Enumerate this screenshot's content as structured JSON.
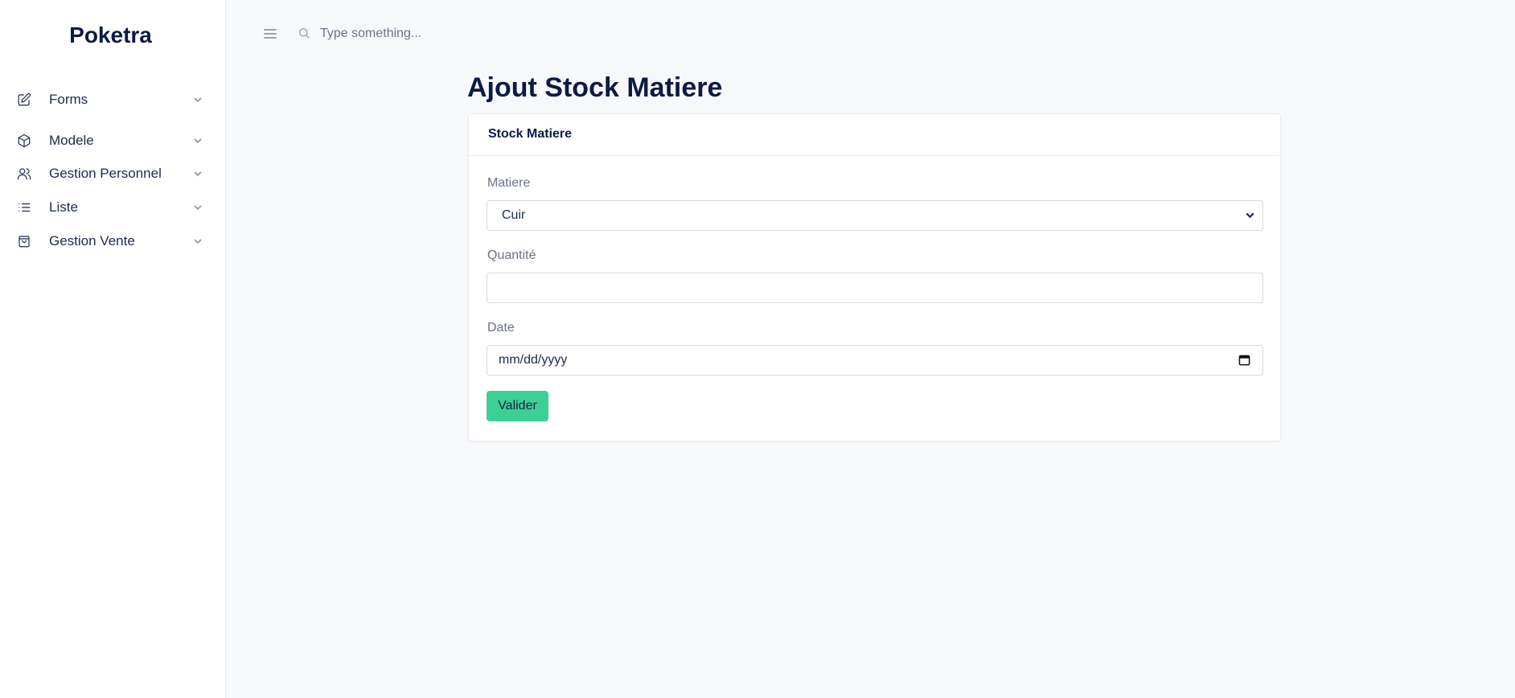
{
  "app": {
    "brand": "Poketra"
  },
  "sidebar": {
    "items": [
      {
        "label": "Forms",
        "icon": "edit-icon"
      },
      {
        "label": "Modele",
        "icon": "cube-icon"
      },
      {
        "label": "Gestion Personnel",
        "icon": "users-icon"
      },
      {
        "label": "Liste",
        "icon": "list-icon"
      },
      {
        "label": "Gestion Vente",
        "icon": "shopping-bag-icon"
      }
    ]
  },
  "topbar": {
    "menu_icon": "hamburger-menu-icon",
    "search_icon": "search-icon",
    "search_placeholder": "Type something..."
  },
  "page": {
    "title": "Ajout Stock Matiere"
  },
  "form": {
    "card_title": "Stock Matiere",
    "matiere": {
      "label": "Matiere",
      "selected": "Cuir"
    },
    "quantite": {
      "label": "Quantité",
      "value": ""
    },
    "date": {
      "label": "Date",
      "placeholder": "mm/dd/yyyy"
    },
    "submit_label": "Valider"
  },
  "colors": {
    "brand": "#0b1b44",
    "accent_button": "#3ecf97",
    "background": "#f7f8fa"
  }
}
